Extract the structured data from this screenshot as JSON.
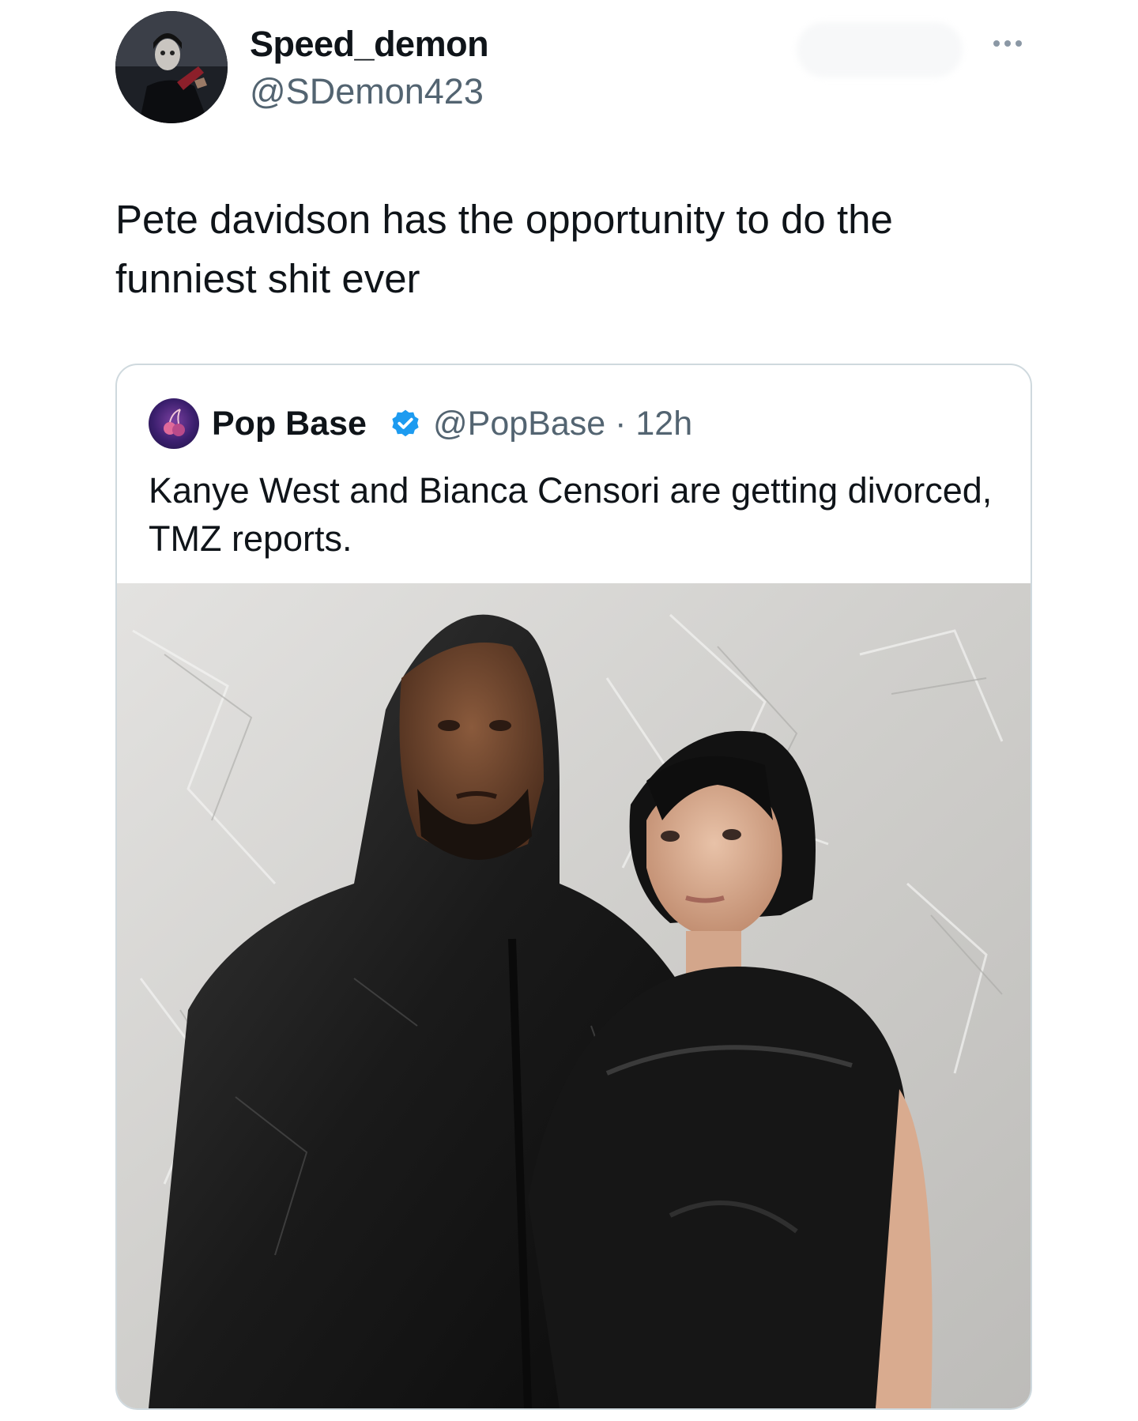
{
  "tweet": {
    "display_name": "Speed_demon",
    "handle": "@SDemon423",
    "text": "Pete davidson has the opportunity to do the funniest shit ever",
    "more_icon": "more-horizontal-icon"
  },
  "quoted_tweet": {
    "display_name": "Pop Base",
    "handle_meta": "@PopBase · 12h",
    "verified_icon": "verified-badge-icon",
    "text": "Kanye West and Bianca Censori are getting divorced, TMZ reports.",
    "verified_color": "#1d9bf0"
  },
  "colors": {
    "text_primary": "#0f1419",
    "text_secondary": "#536471",
    "border": "#cfd9de"
  }
}
